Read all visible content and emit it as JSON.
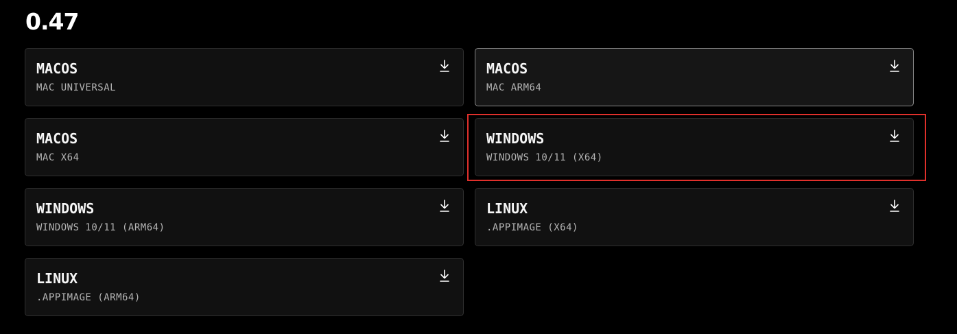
{
  "release": {
    "version": "0.47"
  },
  "downloads": [
    {
      "platform": "MACOS",
      "variant": "MAC UNIVERSAL",
      "icon": "download-icon"
    },
    {
      "platform": "MACOS",
      "variant": "MAC ARM64",
      "icon": "download-icon"
    },
    {
      "platform": "MACOS",
      "variant": "MAC X64",
      "icon": "download-icon"
    },
    {
      "platform": "WINDOWS",
      "variant": "WINDOWS 10/11 (X64)",
      "icon": "download-icon"
    },
    {
      "platform": "WINDOWS",
      "variant": "WINDOWS 10/11 (ARM64)",
      "icon": "download-icon"
    },
    {
      "platform": "LINUX",
      "variant": ".APPIMAGE (X64)",
      "icon": "download-icon"
    },
    {
      "platform": "LINUX",
      "variant": ".APPIMAGE (ARM64)",
      "icon": "download-icon"
    }
  ],
  "colors": {
    "background": "#000000",
    "card_background": "#111111",
    "card_border": "#2f2f2f",
    "hover_border": "#8a8a8a",
    "highlight": "#e0302b"
  }
}
